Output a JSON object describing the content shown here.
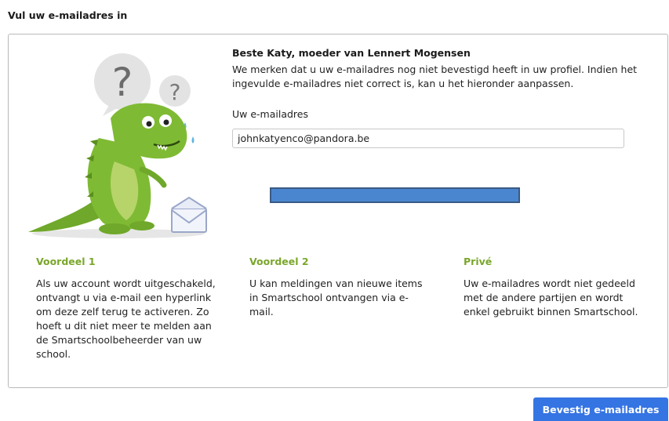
{
  "page": {
    "title": "Vul uw e-mailadres in"
  },
  "greeting": {
    "title": "Beste Katy, moeder van Lennert Mogensen",
    "message": "We merken dat u uw e-mailadres nog niet bevestigd heeft in uw profiel. Indien het ingevulde e-mailadres niet correct is, kan u het hieronder aanpassen."
  },
  "email": {
    "label": "Uw e-mailadres",
    "value": "johnkatyenco@pandora.be"
  },
  "benefits": [
    {
      "title": "Voordeel 1",
      "text": "Als uw account wordt uitgeschakeld, ontvangt u via e-mail een hyperlink om deze zelf terug te activeren. Zo hoeft u dit niet meer te melden aan de Smartschoolbeheerder van uw school."
    },
    {
      "title": "Voordeel 2",
      "text": "U kan meldingen van nieuwe items in Smartschool ontvangen via e-mail."
    },
    {
      "title": "Privé",
      "text": "Uw e-mailadres wordt niet gedeeld met de andere partijen en wordt enkel gebruikt binnen Smartschool."
    }
  ],
  "actions": {
    "confirm_label": "Bevestig e-mailadres"
  },
  "colors": {
    "accent_green": "#7aa62b",
    "button_blue": "#3574e3",
    "redaction_bar": "#4a86d0"
  },
  "icons": {
    "mascot": "confused-dinosaur-illustration",
    "envelope": "envelope-icon"
  }
}
